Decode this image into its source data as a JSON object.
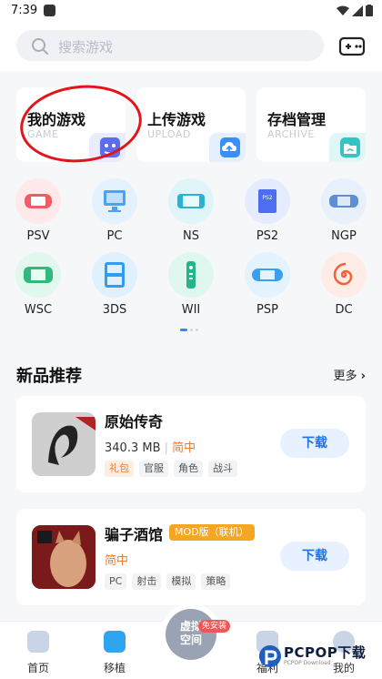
{
  "status": {
    "time": "7:39"
  },
  "search": {
    "placeholder": "搜索游戏"
  },
  "quick_actions": [
    {
      "title": "我的游戏",
      "subtitle": "GAME",
      "accent": "#5b6cf0"
    },
    {
      "title": "上传游戏",
      "subtitle": "UPLOAD",
      "accent": "#3b8ef5"
    },
    {
      "title": "存档管理",
      "subtitle": "ARCHIVE",
      "accent": "#35c4c4"
    }
  ],
  "platforms": [
    {
      "label": "PSV"
    },
    {
      "label": "PC"
    },
    {
      "label": "NS"
    },
    {
      "label": "PS2"
    },
    {
      "label": "NGP"
    },
    {
      "label": "WSC"
    },
    {
      "label": "3DS"
    },
    {
      "label": "WII"
    },
    {
      "label": "PSP"
    },
    {
      "label": "DC"
    }
  ],
  "section": {
    "title": "新品推荐",
    "more": "更多"
  },
  "games": [
    {
      "name": "原始传奇",
      "size": "340.3 MB",
      "lang": "简中",
      "tags": [
        "礼包",
        "官服",
        "角色",
        "战斗"
      ],
      "download": "下载"
    },
    {
      "name": "骗子酒馆",
      "badge": "MOD版（联机）",
      "lang": "简中",
      "tags": [
        "PC",
        "射击",
        "模拟",
        "策略"
      ],
      "download": "下载"
    }
  ],
  "nav": {
    "home": "首页",
    "port": "移植",
    "center": "虚拟空间",
    "center_badge": "免安装",
    "welfare": "福利",
    "mine": "我的"
  },
  "watermark": {
    "name": "PCPOP下载",
    "sub": "PCPOP Download"
  }
}
